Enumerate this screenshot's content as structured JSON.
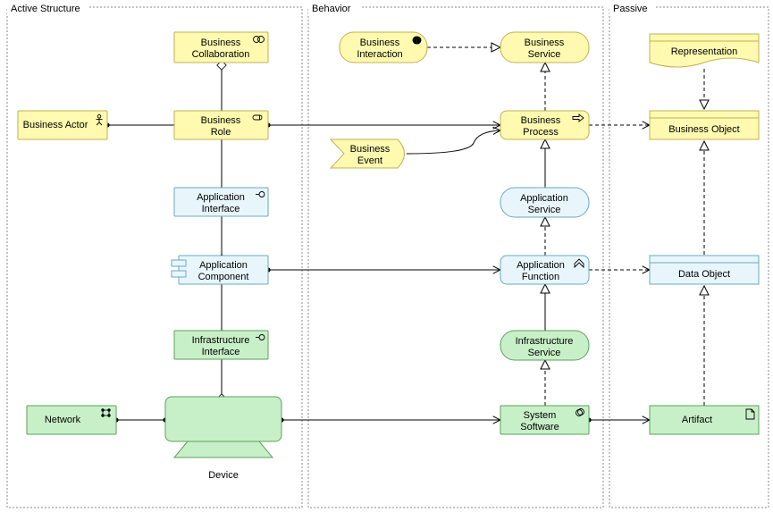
{
  "groups": {
    "active": {
      "label": "Active Structure"
    },
    "behavior": {
      "label": "Behavior"
    },
    "passive": {
      "label": "Passive"
    }
  },
  "nodes": {
    "businessActor": {
      "label1": "Business Actor"
    },
    "businessCollaboration": {
      "label1": "Business",
      "label2": "Collaboration"
    },
    "businessRole": {
      "label1": "Business",
      "label2": "Role"
    },
    "applicationInterface": {
      "label1": "Application",
      "label2": "Interface"
    },
    "applicationComponent": {
      "label1": "Application",
      "label2": "Component"
    },
    "infrastructureInterface": {
      "label1": "Infrastructure",
      "label2": "Interface"
    },
    "network": {
      "label1": "Network"
    },
    "device": {
      "label1": "Device"
    },
    "businessInteraction": {
      "label1": "Business",
      "label2": "Interaction"
    },
    "businessService": {
      "label1": "Business",
      "label2": "Service"
    },
    "businessProcess": {
      "label1": "Business",
      "label2": "Process"
    },
    "businessEvent": {
      "label1": "Business",
      "label2": "Event"
    },
    "applicationService": {
      "label1": "Application",
      "label2": "Service"
    },
    "applicationFunction": {
      "label1": "Application",
      "label2": "Function"
    },
    "infrastructureService": {
      "label1": "Infrastructure",
      "label2": "Service"
    },
    "systemSoftware": {
      "label1": "System",
      "label2": "Software"
    },
    "representation": {
      "label1": "Representation"
    },
    "businessObject": {
      "label1": "Business Object"
    },
    "dataObject": {
      "label1": "Data Object"
    },
    "artifact": {
      "label1": "Artifact"
    }
  },
  "colors": {
    "yellowFill": "#fffab0",
    "yellowStroke": "#c0b050",
    "blueFill": "#e8f6fc",
    "blueStroke": "#6aa8bf",
    "greenFill": "#c8f0c8",
    "greenStroke": "#5aa05a",
    "groupStroke": "#888"
  }
}
